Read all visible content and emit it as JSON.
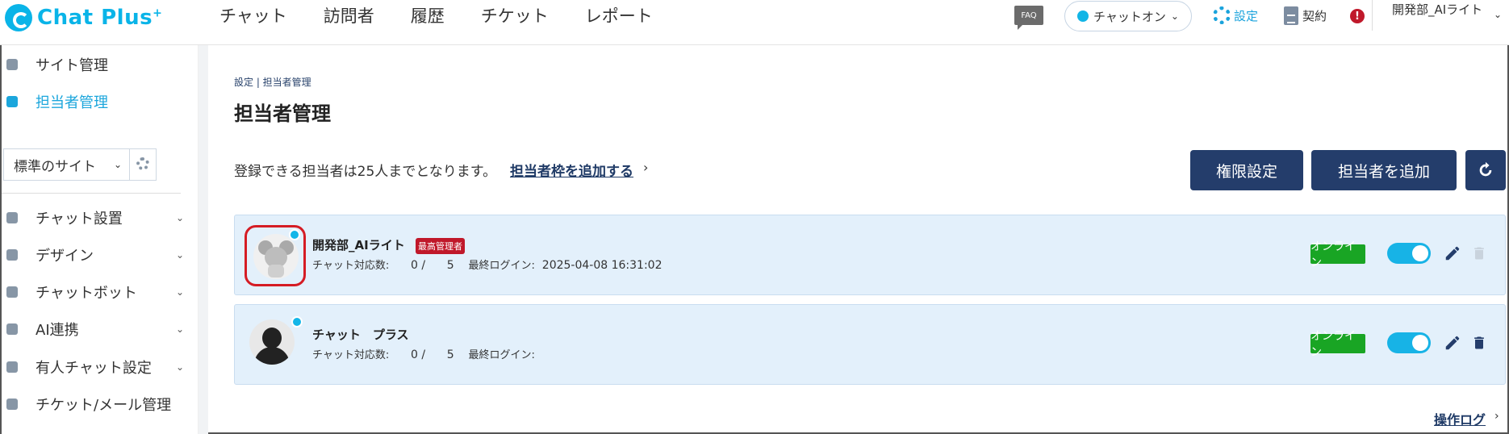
{
  "header": {
    "logo_text": "Chat Plus",
    "logo_sup": "+",
    "nav": [
      "チャット",
      "訪問者",
      "履歴",
      "チケット",
      "レポート"
    ],
    "faq": "FAQ",
    "chat_status": "チャットオン",
    "settings": "設定",
    "contract": "契約",
    "alert": "!",
    "user": "開発部_AIライト"
  },
  "sidebar": {
    "site_admin": "サイト管理",
    "operator_admin": "担当者管理",
    "site_select": "標準のサイト",
    "items": [
      "チャット設置",
      "デザイン",
      "チャットボット",
      "AI連携",
      "有人チャット設定",
      "チケット/メール管理"
    ]
  },
  "main": {
    "breadcrumb": "設定 | 担当者管理",
    "title": "担当者管理",
    "limit_text": "登録できる担当者は25人までとなります。",
    "add_slot_link": "担当者枠を追加する",
    "arrow": "›",
    "btn_permission": "権限設定",
    "btn_add": "担当者を追加",
    "operators": [
      {
        "name": "開発部_AIライト",
        "role": "最高管理者",
        "chat_label": "チャット対応数:",
        "chat_count": "0",
        "chat_max": "5",
        "login_label": "最終ログイン:",
        "last_login": "2025-04-08 16:31:02",
        "status": "オンライン"
      },
      {
        "name": "チャット　プラス",
        "role": "",
        "chat_label": "チャット対応数:",
        "chat_count": "0",
        "chat_max": "5",
        "login_label": "最終ログイン:",
        "last_login": "",
        "status": "オンライン"
      }
    ],
    "op_log": "操作ログ"
  },
  "colors": {
    "accent": "#1ba6dc",
    "button": "#243d6b",
    "online": "#19a524",
    "admin_badge": "#c0182a",
    "card_bg": "#e3f0fb"
  }
}
